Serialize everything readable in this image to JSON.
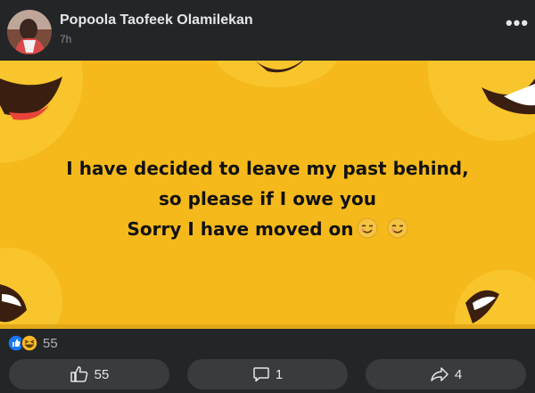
{
  "post": {
    "author": "Popoola Taofeek Olamilekan",
    "time": "7h",
    "text_lines": [
      "I have decided to leave my past behind,",
      "so please if I owe you",
      "Sorry I have moved on"
    ],
    "emoji_after_last_line": [
      "smirk-wink-emoji",
      "smirk-wink-emoji"
    ],
    "background_color": "#f5b91b"
  },
  "reactions": {
    "icons": [
      "like-reaction-icon",
      "haha-reaction-icon"
    ],
    "count": "55"
  },
  "actions": {
    "like_count": "55",
    "comment_count": "1",
    "share_count": "4"
  },
  "colors": {
    "panel": "#242526",
    "button": "#3a3b3c",
    "like_blue": "#1877f2",
    "haha_yellow": "#f7b928"
  }
}
